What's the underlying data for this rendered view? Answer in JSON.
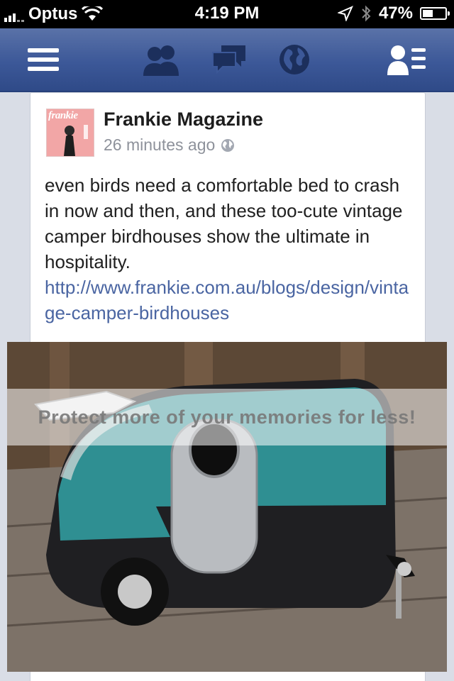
{
  "status_bar": {
    "carrier": "Optus",
    "time": "4:19 PM",
    "battery": "47%",
    "battery_level": 0.47,
    "icons": [
      "signal-bars-icon",
      "wifi-icon",
      "location-arrow-icon",
      "bluetooth-icon",
      "battery-charging-icon"
    ]
  },
  "nav_bar": {
    "icons": [
      "menu-icon",
      "friend-requests-icon",
      "messages-icon",
      "notifications-globe-icon",
      "contacts-icon"
    ],
    "color": "#3c5898"
  },
  "post": {
    "author": "Frankie Magazine",
    "avatar_text": "frankie",
    "timestamp": "26 minutes ago",
    "privacy_icon": "globe-icon",
    "text": "even birds need a comfortable bed to crash in now and then, and these too-cute vintage camper birdhouses show the ultimate in hospitality.",
    "link": "http://www.frankie.com.au/blogs/design/vintage-camper-birdhouses",
    "photo": {
      "subject": "vintage camper birdhouse",
      "watermark": "Protect more of your memories for less!"
    }
  }
}
